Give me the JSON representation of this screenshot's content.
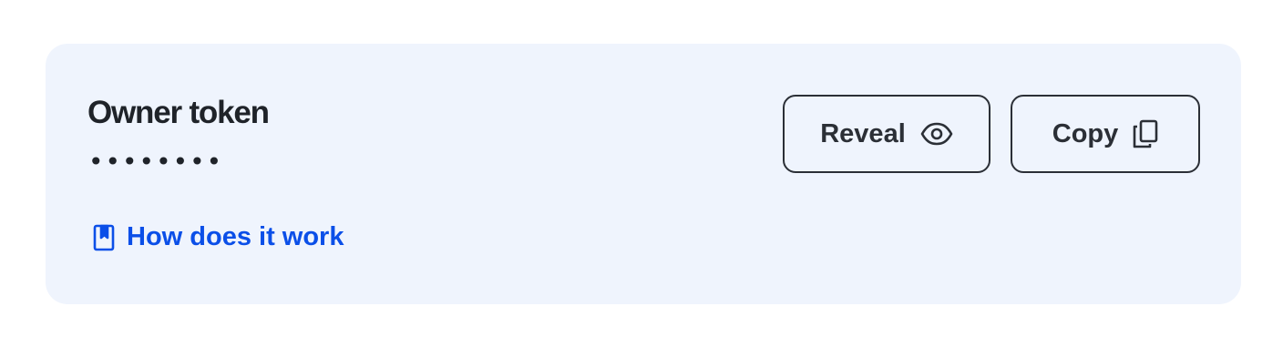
{
  "token_card": {
    "title": "Owner token",
    "masked_value": "••••••••",
    "reveal_label": "Reveal",
    "reveal_icon": "eye-icon",
    "copy_label": "Copy",
    "copy_icon": "copy-icon",
    "help_link_label": "How does it work",
    "help_link_icon": "book-icon"
  },
  "colors": {
    "card_background": "#eff4fd",
    "text_primary": "#1f2329",
    "button_border": "#2b2f36",
    "link_accent": "#0b4fe8"
  }
}
